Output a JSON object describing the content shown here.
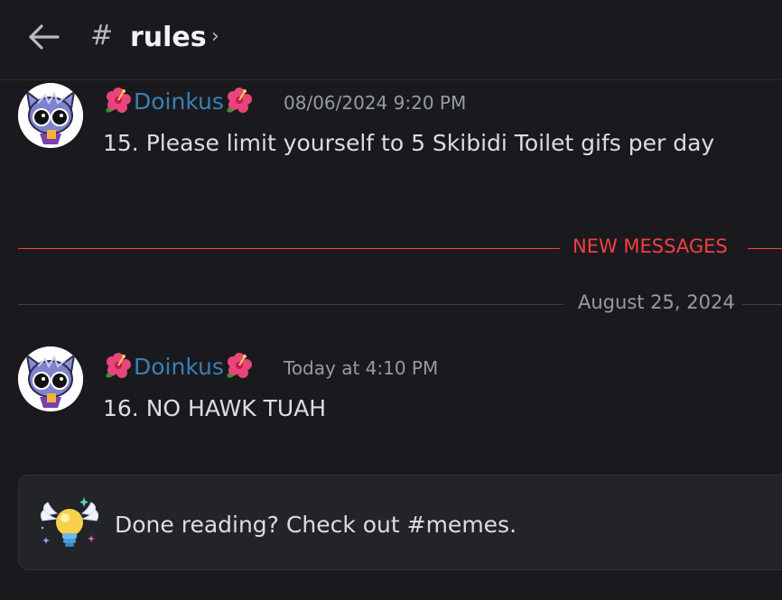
{
  "header": {
    "hash_symbol": "#",
    "channel_name": "rules",
    "chevron": "›"
  },
  "messages": [
    {
      "username": "Doinkus",
      "timestamp": "08/06/2024 9:20 PM",
      "content": "15.  Please limit yourself to 5 Skibidi Toilet gifs per day"
    },
    {
      "username": "Doinkus",
      "timestamp": "Today at 4:10 PM",
      "content": "16.  NO HAWK TUAH"
    }
  ],
  "dividers": {
    "new_messages": "NEW MESSAGES",
    "date": "August 25, 2024"
  },
  "banner": {
    "text": "Done reading? Check out #memes."
  },
  "colors": {
    "background": "#1a1a1e",
    "username": "#3a7fb8",
    "new_messages_red": "#f23f43",
    "timestamp_gray": "#949ba4"
  },
  "icons": {
    "back": "arrow-left-icon",
    "flower": "hibiscus-emoji",
    "banner": "winged-lightbulb-icon"
  }
}
